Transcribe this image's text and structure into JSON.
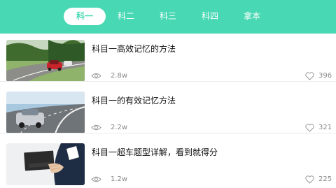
{
  "tabs": [
    {
      "label": "科一",
      "active": true
    },
    {
      "label": "科二",
      "active": false
    },
    {
      "label": "科三",
      "active": false
    },
    {
      "label": "科四",
      "active": false
    },
    {
      "label": "拿本",
      "active": false
    }
  ],
  "articles": [
    {
      "title": "科目一高效记忆的方法",
      "views": "2.8w",
      "likes": "396",
      "thumb": "car-road-photo"
    },
    {
      "title": "科目一的有效记忆方法",
      "views": "2.2w",
      "likes": "321",
      "thumb": "car-curve-photo"
    },
    {
      "title": "科目一超车题型详解，看到就得分",
      "views": "1.2w",
      "likes": "225",
      "thumb": "license-card-photo"
    }
  ],
  "icons": {
    "views": "eye-icon",
    "likes": "heart-icon"
  },
  "colors": {
    "accent": "#48d8b3",
    "meta_text": "#888888"
  }
}
